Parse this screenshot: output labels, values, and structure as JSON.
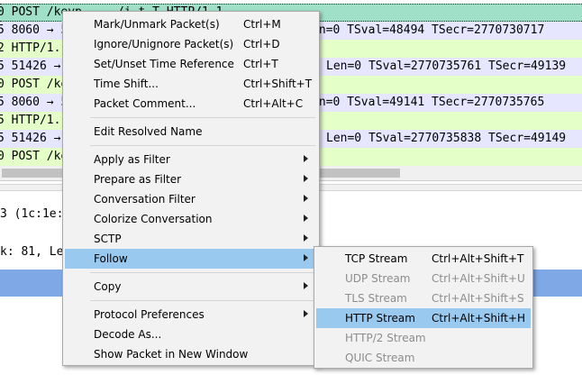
{
  "packet_rows": [
    {
      "text": "0 POST /keyp...../i.t T HTTP/1.1",
      "style": "sel"
    },
    {
      "text": "5 8060 → 5",
      "tail": "en=0 TSval=48494 TSecr=2770730717",
      "style": "blue"
    },
    {
      "text": "2 HTTP/1.1",
      "tail": "",
      "style": "green"
    },
    {
      "text": "5 51426 →",
      "tail": "Len=0 TSval=2770735761 TSecr=49139",
      "style": "blue"
    },
    {
      "text": "0 POST /ke",
      "tail": "",
      "style": "green"
    },
    {
      "text": "5 8060 → 5",
      "tail": "en=0 TSval=49141 TSecr=2770735765",
      "style": "blue"
    },
    {
      "text": "5 HTTP/1.1",
      "tail": "",
      "style": "green"
    },
    {
      "text": "5 51426 →",
      "tail": "Len=0 TSval=2770735838 TSecr=49149",
      "style": "blue"
    },
    {
      "text": "0 POST /ke",
      "tail": "",
      "style": "green"
    }
  ],
  "details": {
    "line1": "3 (1c:1e:e",
    "line2": "k: 81, Le"
  },
  "context_menu": {
    "items": [
      {
        "label": "Mark/Unmark Packet(s)",
        "shortcut": "Ctrl+M"
      },
      {
        "label": "Ignore/Unignore Packet(s)",
        "shortcut": "Ctrl+D"
      },
      {
        "label": "Set/Unset Time Reference",
        "shortcut": "Ctrl+T"
      },
      {
        "label": "Time Shift...",
        "shortcut": "Ctrl+Shift+T"
      },
      {
        "label": "Packet Comment...",
        "shortcut": "Ctrl+Alt+C"
      },
      {
        "label": "Edit Resolved Name"
      },
      {
        "label": "Apply as Filter",
        "submenu": true
      },
      {
        "label": "Prepare as Filter",
        "submenu": true
      },
      {
        "label": "Conversation Filter",
        "submenu": true
      },
      {
        "label": "Colorize Conversation",
        "submenu": true
      },
      {
        "label": "SCTP",
        "submenu": true
      },
      {
        "label": "Follow",
        "submenu": true,
        "highlighted": true
      },
      {
        "label": "Copy",
        "submenu": true
      },
      {
        "label": "Protocol Preferences",
        "submenu": true
      },
      {
        "label": "Decode As..."
      },
      {
        "label": "Show Packet in New Window"
      }
    ]
  },
  "follow_submenu": {
    "items": [
      {
        "label": "TCP Stream",
        "shortcut": "Ctrl+Alt+Shift+T",
        "enabled": true
      },
      {
        "label": "UDP Stream",
        "shortcut": "Ctrl+Alt+Shift+U",
        "enabled": false
      },
      {
        "label": "TLS Stream",
        "shortcut": "Ctrl+Alt+Shift+S",
        "enabled": false
      },
      {
        "label": "HTTP Stream",
        "shortcut": "Ctrl+Alt+Shift+H",
        "enabled": true,
        "highlighted": true
      },
      {
        "label": "HTTP/2 Stream",
        "enabled": false
      },
      {
        "label": "QUIC Stream",
        "enabled": false
      }
    ]
  },
  "colors": {
    "row_green": "#e4ffc7",
    "row_blue": "#e7e6ff",
    "row_selected": "#a0e0c8",
    "menu_highlight": "#99c9ef",
    "detail_selected": "#7fa8e6"
  }
}
